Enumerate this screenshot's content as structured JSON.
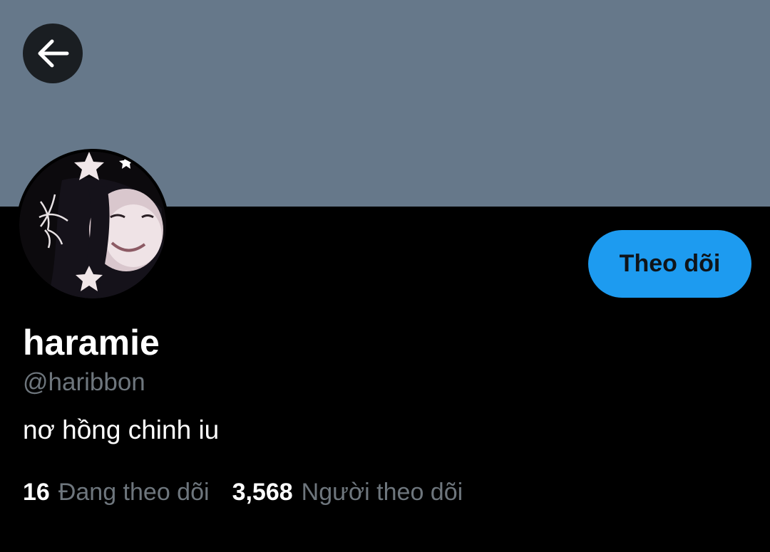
{
  "profile": {
    "display_name": "haramie",
    "handle": "@haribbon",
    "bio": "nơ hồng chinh iu",
    "banner_color": "#66788a"
  },
  "actions": {
    "back_icon": "arrow-left-icon",
    "follow_label": "Theo dõi",
    "follow_color": "#1d9bf0"
  },
  "stats": {
    "following_count": "16",
    "following_label": "Đang theo dõi",
    "followers_count": "3,568",
    "followers_label": "Người theo dõi"
  },
  "colors": {
    "background": "#000000",
    "primary_text": "#ffffff",
    "secondary_text": "#6e767d"
  }
}
